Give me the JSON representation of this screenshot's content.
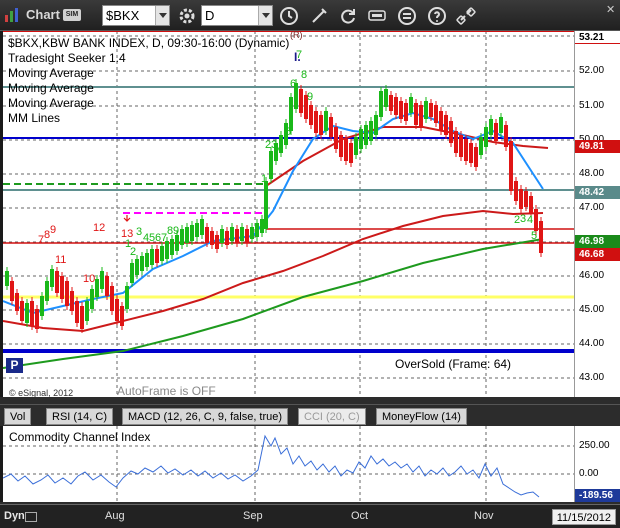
{
  "toolbar": {
    "title": "Chart",
    "sim_badge": "SIM",
    "symbol": "$BKX",
    "interval": "D"
  },
  "chart": {
    "header_line": "$BKX,KBW BANK INDEX, D, 09:30-16:00 (Dynamic)",
    "studies": [
      "Tradesight Seeker 1.4",
      "Moving Average",
      "Moving Average",
      "Moving Average",
      "MM Lines"
    ],
    "oversold_label": "OverSold (Frame: 64)",
    "autoframe_label": "AutoFrame is OFF",
    "copyright": "© eSignal, 2012",
    "p_marker": "P"
  },
  "price_axis": {
    "ticks": [
      "53.21",
      "52.00",
      "51.00",
      "50.00",
      "49.00",
      "48.00",
      "47.00",
      "46.00",
      "45.00",
      "44.00",
      "43.00"
    ],
    "badges": [
      {
        "label": "53.21",
        "color": "#ffffff",
        "text": "#000000"
      },
      {
        "label": "49.81",
        "color": "#d01010",
        "text": "#ffffff"
      },
      {
        "label": "48.42",
        "color": "#5a8a8a",
        "text": "#ffffff"
      },
      {
        "label": "46.98",
        "color": "#1a8a1a",
        "text": "#ffffff"
      },
      {
        "label": "46.68",
        "color": "#d01010",
        "text": "#ffffff"
      }
    ]
  },
  "study_tabs": [
    "Vol",
    "RSI (14, C)",
    "MACD (12, 26, C, 9, false, true)",
    "CCI (20, C)",
    "MoneyFlow (14)"
  ],
  "cci": {
    "title": "Commodity Channel Index",
    "ticks": [
      "250.00",
      "0.00"
    ],
    "current": "-189.56"
  },
  "time_axis": {
    "dyn_label": "Dyn",
    "months": [
      "Aug",
      "Sep",
      "Oct",
      "Nov"
    ],
    "date_readout": "11/15/2012"
  },
  "seeker_labels": {
    "red": [
      "7",
      "8",
      "9",
      "12",
      "13",
      "11",
      "10"
    ],
    "green": [
      "1",
      "2",
      "3",
      "4",
      "5",
      "6",
      "7",
      "8",
      "9",
      "2",
      "3",
      "4",
      "5",
      "6",
      "7",
      "8",
      "9",
      "2",
      "3",
      "4",
      "5",
      "2",
      "4"
    ],
    "setup_marks": [
      "R",
      "I"
    ]
  },
  "colors": {
    "up_candle": "#19b819",
    "down_candle": "#e01515",
    "ma_fast": "#1e90ff",
    "ma_mid": "#cc1a1a",
    "ma_slow": "#1e9a1e",
    "mm_teal": "#5f9090",
    "mm_blue": "#0000cc",
    "mm_yellow": "#ffff66",
    "mm_magenta": "#ff00ff",
    "cci_line": "#3a6ed8"
  }
}
